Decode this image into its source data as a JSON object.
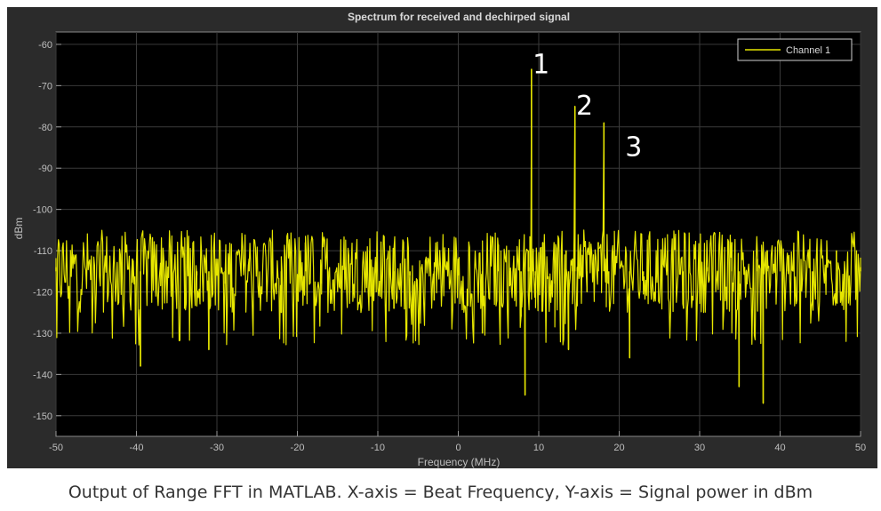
{
  "caption": "Output of Range FFT in MATLAB. X-axis = Beat Frequency, Y-axis = Signal power in dBm",
  "chart_data": {
    "type": "line",
    "title": "Spectrum for received and dechirped signal",
    "xlabel": "Frequency (MHz)",
    "ylabel": "dBm",
    "xlim": [
      -50,
      50
    ],
    "ylim": [
      -155,
      -57
    ],
    "grid": true,
    "legend_position": "top-right",
    "xticks": [
      "-50",
      "-40",
      "-30",
      "-20",
      "-10",
      "0",
      "10",
      "20",
      "30",
      "40",
      "50"
    ],
    "yticks": [
      "-60",
      "-70",
      "-80",
      "-90",
      "-100",
      "-110",
      "-120",
      "-130",
      "-140",
      "-150"
    ],
    "noise_floor": {
      "mean": -115,
      "band": [
        -127,
        -107
      ]
    },
    "series": [
      {
        "name": "Channel 1",
        "color": "#e6e600",
        "x": [
          -50,
          -40.5,
          -39.5,
          -37,
          -34,
          -32.5,
          -31,
          -29,
          -26,
          -22,
          -19,
          -17,
          -14,
          -11,
          -8,
          -6,
          -3,
          0,
          3,
          5,
          6.5,
          7.8,
          8.3,
          8.7,
          8.9,
          9.1,
          9.3,
          9.6,
          10.5,
          12,
          13.4,
          13.7,
          14.2,
          14.5,
          14.8,
          15.1,
          16,
          17.4,
          17.8,
          18.1,
          18.4,
          18.7,
          19.4,
          21.3,
          23,
          26,
          28,
          31,
          34,
          34.9,
          35.8,
          37.2,
          37.9,
          38.4,
          41,
          44,
          47,
          50
        ],
        "y": [
          -114,
          -112,
          -138,
          -113,
          -124,
          -116,
          -134,
          -118,
          -112,
          -125,
          -108,
          -118,
          -114,
          -110,
          -124,
          -116,
          -122,
          -112,
          -130,
          -110,
          -118,
          -126,
          -145,
          -110,
          -114,
          -66,
          -110,
          -116,
          -108,
          -118,
          -110,
          -134,
          -112,
          -75,
          -114,
          -116,
          -120,
          -108,
          -115,
          -79,
          -112,
          -118,
          -110,
          -136,
          -116,
          -110,
          -124,
          -114,
          -108,
          -143,
          -118,
          -112,
          -147,
          -110,
          -112,
          -122,
          -110,
          -114
        ]
      }
    ],
    "annotations": [
      {
        "text": "1",
        "x": 10.3,
        "y": -67
      },
      {
        "text": "2",
        "x": 15.7,
        "y": -77
      },
      {
        "text": "3",
        "x": 21.8,
        "y": -87
      }
    ]
  }
}
